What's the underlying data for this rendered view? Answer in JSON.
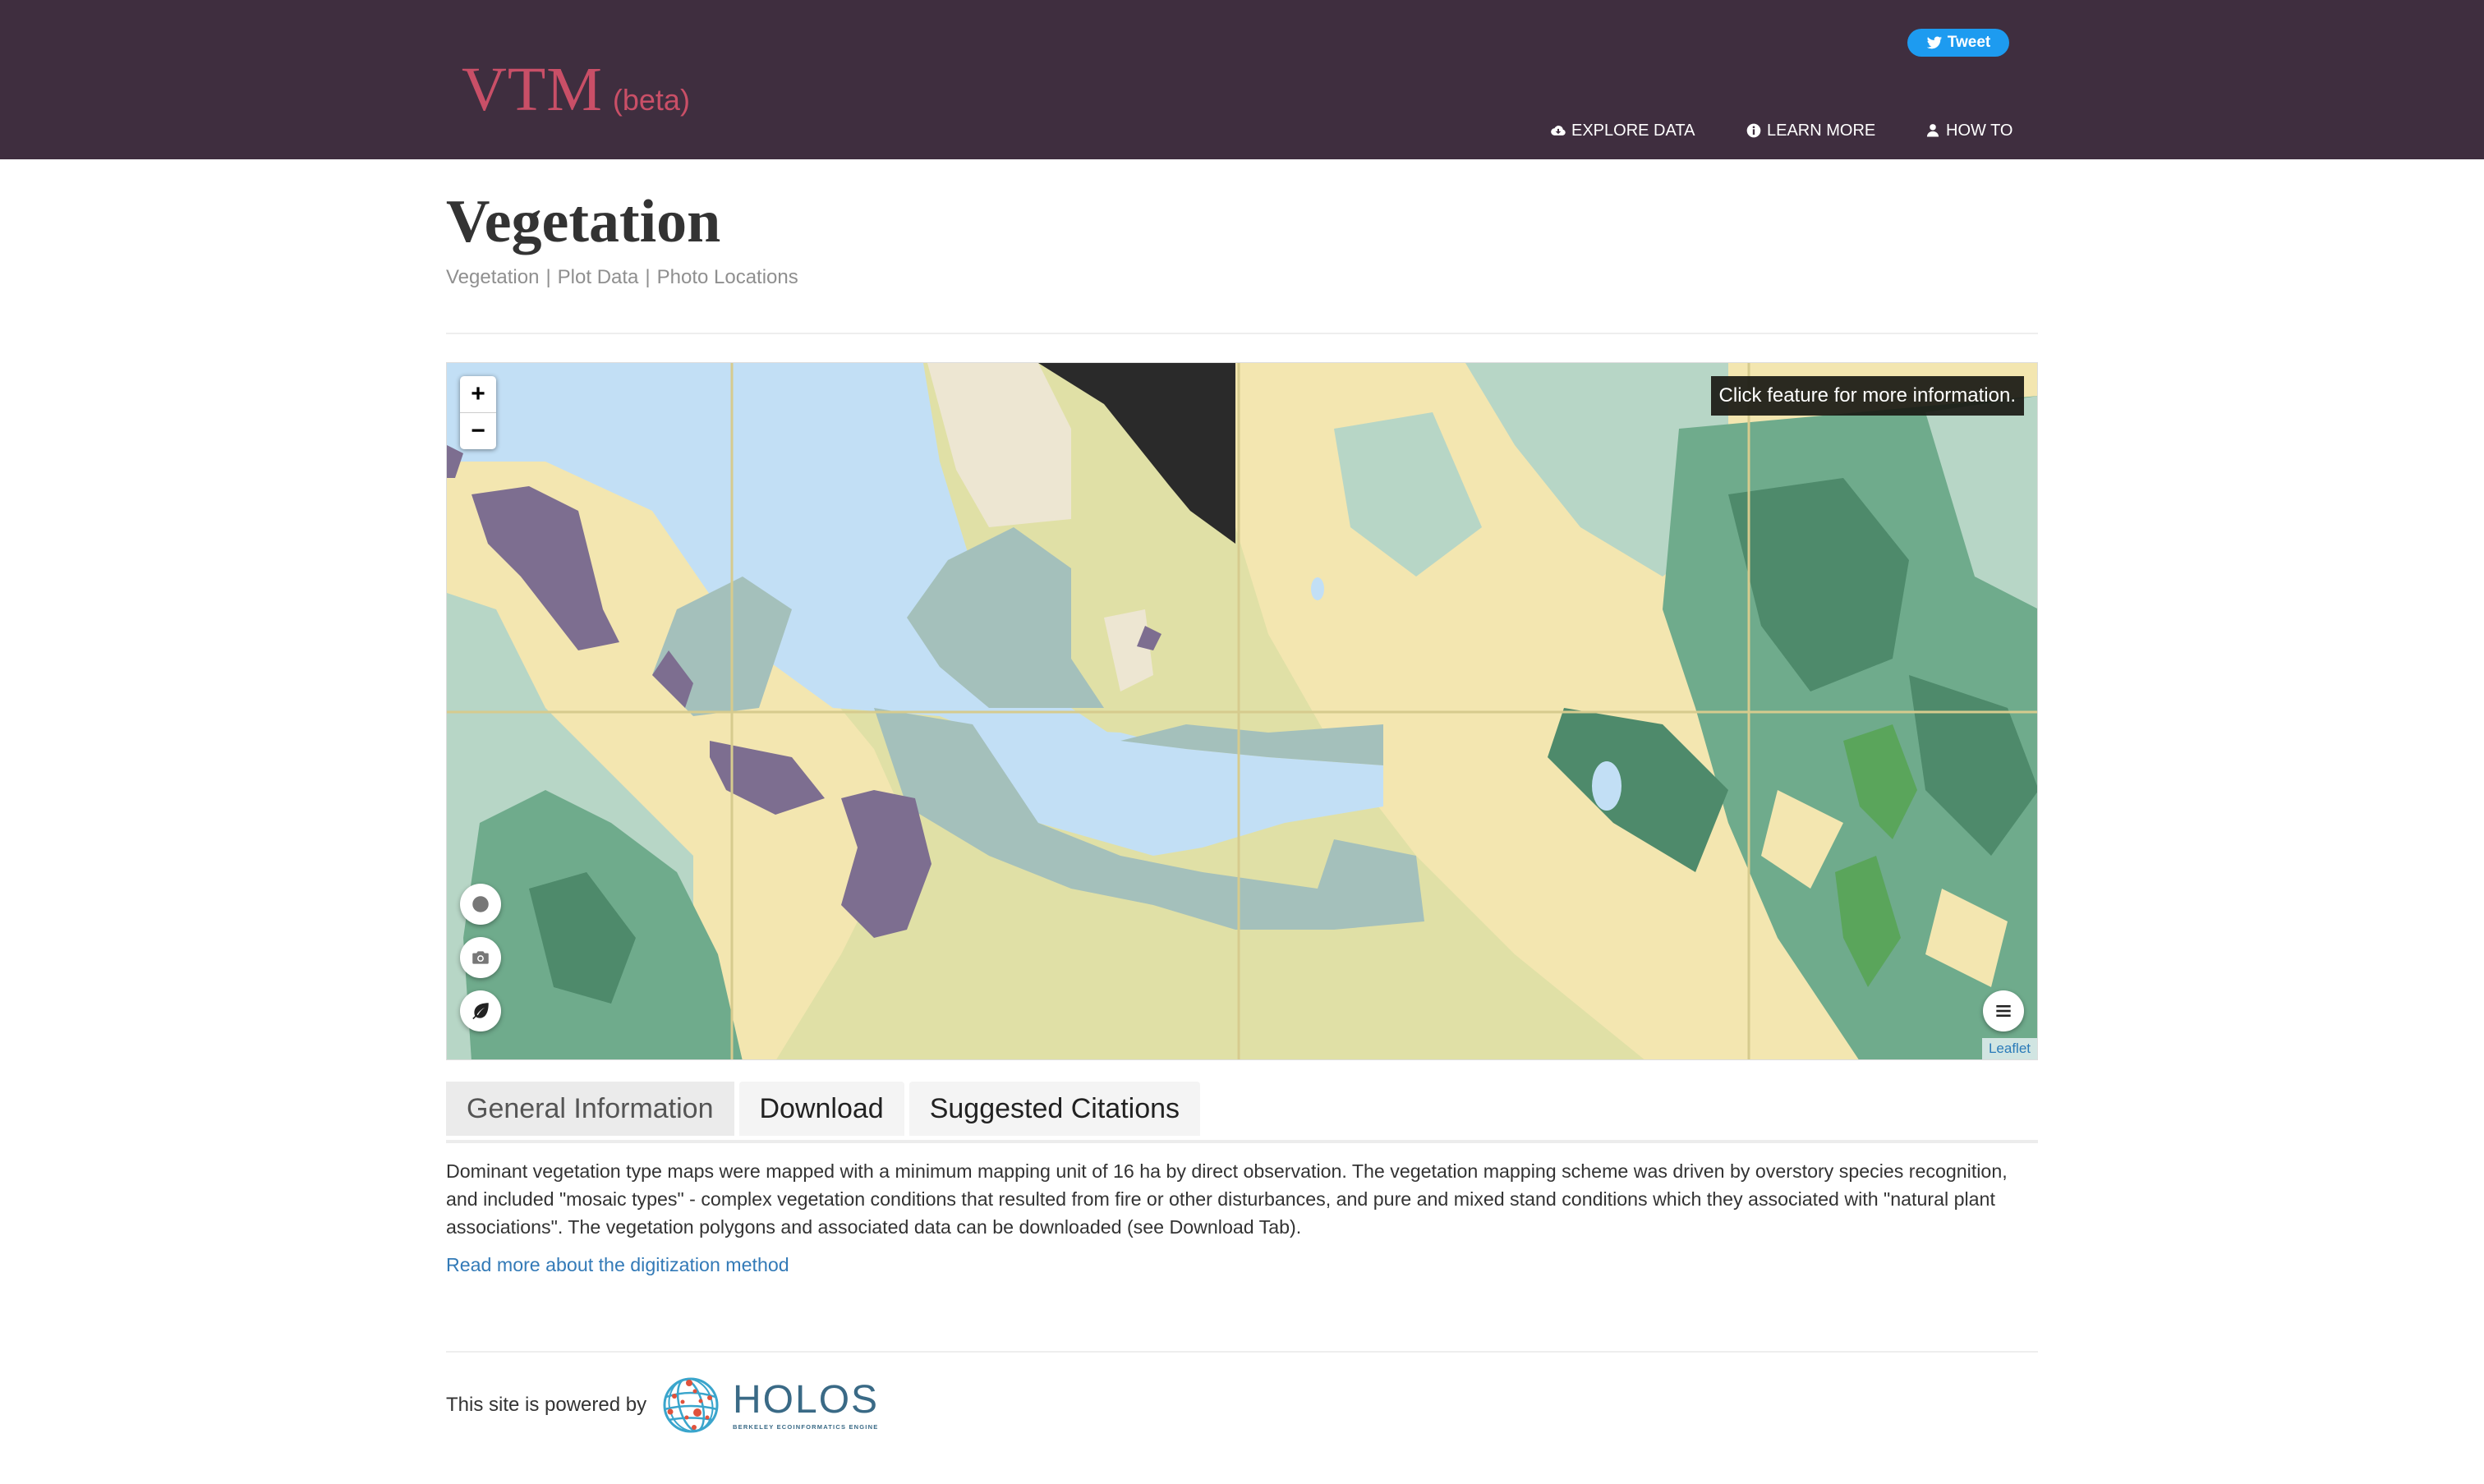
{
  "header": {
    "brand": "VTM",
    "brand_suffix": "(beta)",
    "tweet_label": "Tweet",
    "nav": [
      {
        "label": "EXPLORE DATA",
        "icon": "cloud-download-icon"
      },
      {
        "label": "LEARN MORE",
        "icon": "info-circle-icon"
      },
      {
        "label": "HOW TO",
        "icon": "user-icon"
      }
    ]
  },
  "page": {
    "title": "Vegetation",
    "subnav": [
      "Vegetation",
      "Plot Data",
      "Photo Locations"
    ],
    "subnav_separator": "|"
  },
  "map": {
    "zoom_in": "+",
    "zoom_out": "−",
    "info_text": "Click feature for more information.",
    "attribution": "Leaflet",
    "layer_buttons": [
      {
        "icon": "circle-icon",
        "layer": "plot-data"
      },
      {
        "icon": "camera-icon",
        "layer": "photo-locations"
      },
      {
        "icon": "leaf-icon",
        "layer": "vegetation"
      }
    ],
    "legend_button_icon": "menu-icon",
    "colors": {
      "water": "#c2dff5",
      "grassland": "#f3e6b0",
      "agriculture": "#e0e0a6",
      "marsh": "#a4c0bb",
      "urban_purple": "#7d6e90",
      "urban_dark": "#2a2a2a",
      "barren": "#ede6d2",
      "oak_woodland": "#6fab8c",
      "dense_forest": "#4e8a6b",
      "scrub": "#b7d6c6",
      "conifer_bright": "#5aa55b",
      "grid": "#d6cb8e"
    }
  },
  "tabs": [
    {
      "label": "General Information",
      "active": true
    },
    {
      "label": "Download",
      "active": false
    },
    {
      "label": "Suggested Citations",
      "active": false
    }
  ],
  "general_information": {
    "description": "Dominant vegetation type maps were mapped with a minimum mapping unit of 16 ha by direct observation. The vegetation mapping scheme was driven by overstory species recognition, and included \"mosaic types\" - complex vegetation conditions that resulted from fire or other disturbances, and pure and mixed stand conditions which they associated with \"natural plant associations\". The vegetation polygons and associated data can be downloaded (see Download Tab).",
    "read_more": "Read more about the digitization method"
  },
  "footer": {
    "powered_by": "This site is powered by",
    "logo_name": "HOLOS",
    "logo_tagline": "BERKELEY ECOINFORMATICS ENGINE"
  }
}
